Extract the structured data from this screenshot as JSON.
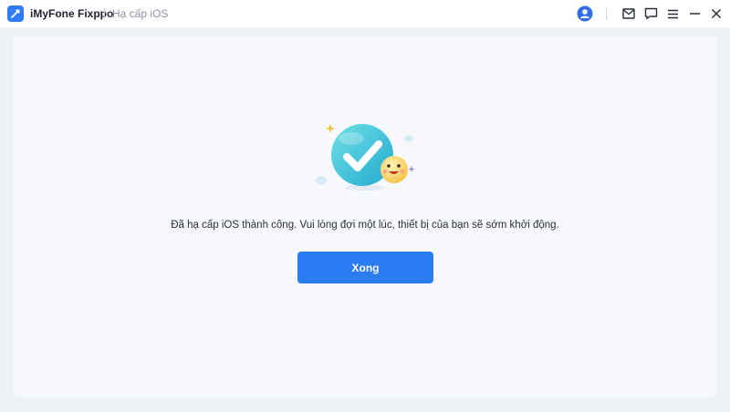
{
  "window": {
    "app_name": "iMyFone Fixppo",
    "mode": "Hạ cấp iOS"
  },
  "toolbar": {
    "icons": [
      "logo-icon",
      "user-avatar-icon",
      "mail-icon",
      "chat-icon",
      "menu-icon",
      "minimize-icon",
      "close-icon"
    ]
  },
  "main": {
    "message": "Đã hạ cấp iOS thành công. Vui lòng đợi một lúc, thiết bị của bạn sẽ sớm khởi động.",
    "done_label": "Xong"
  },
  "colors": {
    "accent": "#2b7bf3",
    "success": "#3ec7d8",
    "background": "#eef1f6"
  }
}
